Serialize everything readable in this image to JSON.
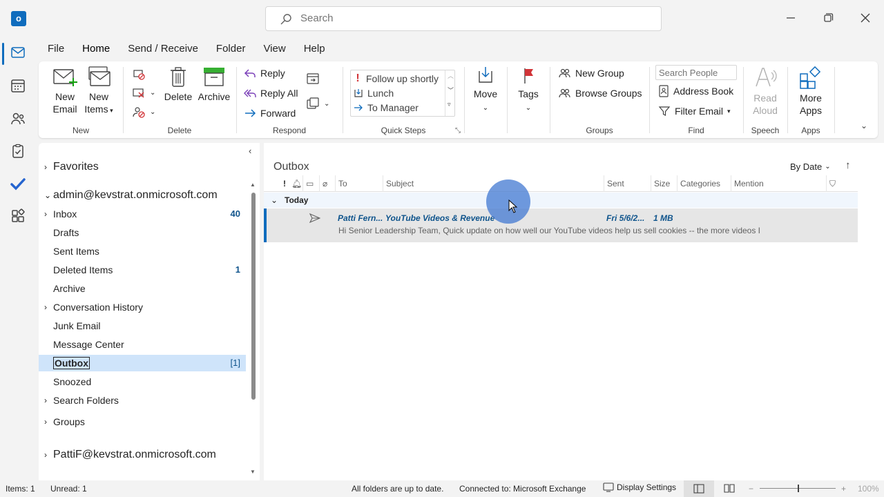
{
  "search": {
    "placeholder": "Search"
  },
  "menu": {
    "tabs": [
      "File",
      "Home",
      "Send / Receive",
      "Folder",
      "View",
      "Help"
    ],
    "active": "Home"
  },
  "ribbon": {
    "new": {
      "new_email": "New Email",
      "new_items": "New Items",
      "label": "New"
    },
    "delete": {
      "delete": "Delete",
      "archive": "Archive",
      "label": "Delete"
    },
    "respond": {
      "reply": "Reply",
      "reply_all": "Reply All",
      "forward": "Forward",
      "label": "Respond"
    },
    "quick_steps": {
      "items": [
        "Follow up shortly",
        "Lunch",
        "To Manager"
      ],
      "label": "Quick Steps"
    },
    "move": {
      "move": "Move"
    },
    "tags": {
      "tags": "Tags"
    },
    "groups": {
      "new_group": "New Group",
      "browse_groups": "Browse Groups",
      "label": "Groups"
    },
    "find": {
      "search_people_placeholder": "Search People",
      "address_book": "Address Book",
      "filter_email": "Filter Email",
      "label": "Find"
    },
    "speech": {
      "read_aloud": "Read Aloud",
      "label": "Speech"
    },
    "apps": {
      "more_apps": "More Apps",
      "label": "Apps"
    }
  },
  "folders": {
    "favorites": "Favorites",
    "account": "admin@kevstrat.onmicrosoft.com",
    "items": [
      {
        "label": "Inbox",
        "count": "40",
        "expandable": true
      },
      {
        "label": "Drafts",
        "count": ""
      },
      {
        "label": "Sent Items",
        "count": ""
      },
      {
        "label": "Deleted Items",
        "count": "1"
      },
      {
        "label": "Archive",
        "count": ""
      },
      {
        "label": "Conversation History",
        "count": "",
        "expandable": true
      },
      {
        "label": "Junk Email",
        "count": ""
      },
      {
        "label": "Message Center",
        "count": ""
      },
      {
        "label": "Outbox",
        "count": "[1]",
        "selected": true
      },
      {
        "label": "Snoozed",
        "count": ""
      },
      {
        "label": "Search Folders",
        "count": "",
        "expandable": true
      }
    ],
    "groups": "Groups",
    "account2": "PattiF@kevstrat.onmicrosoft.com"
  },
  "list": {
    "title": "Outbox",
    "sort": "By Date",
    "columns": {
      "to": "To",
      "subject": "Subject",
      "sent": "Sent",
      "size": "Size",
      "categories": "Categories",
      "mention": "Mention"
    },
    "group": "Today",
    "messages": [
      {
        "from": "Patti Fern...",
        "subject": "YouTube Videos & Revenue",
        "sent": "Fri 5/6/2...",
        "size": "1 MB",
        "preview": "Hi Senior Leadership Team,  Quick update on how well our YouTube videos help us sell cookies -- the more videos I"
      }
    ]
  },
  "status": {
    "items": "Items: 1",
    "unread": "Unread: 1",
    "sync": "All folders are up to date.",
    "connection": "Connected to: Microsoft Exchange",
    "display_settings": "Display Settings",
    "zoom": "100%"
  },
  "colors": {
    "accent": "#0f6cbd",
    "selected": "#cfe4fa",
    "flag": "#d13438"
  }
}
